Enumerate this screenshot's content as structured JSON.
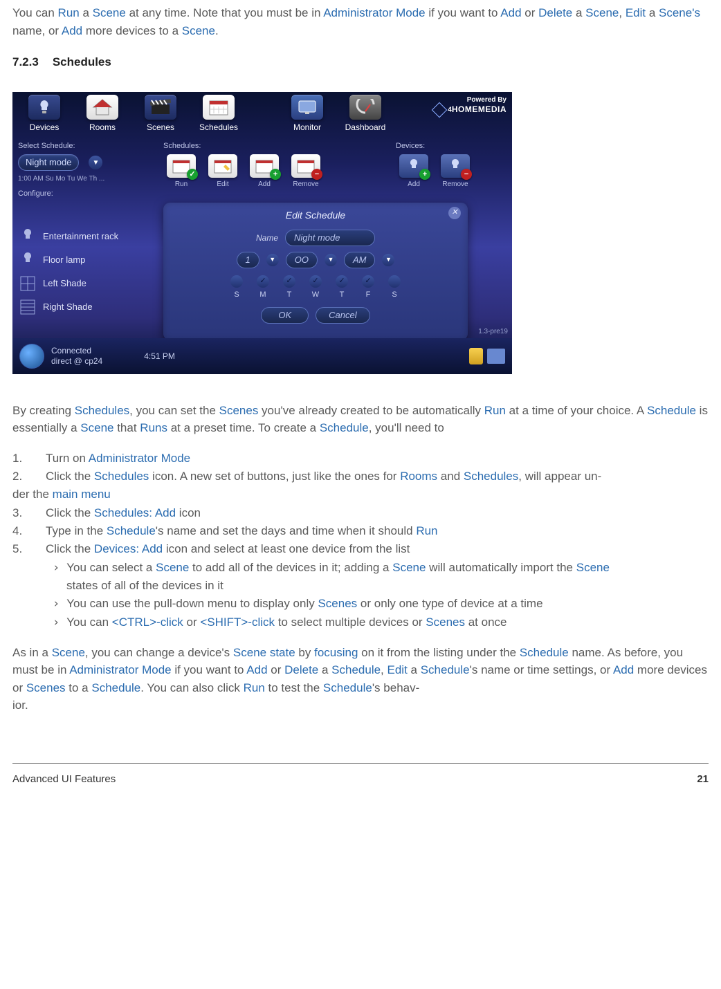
{
  "intro": {
    "t1": "You can ",
    "run": "Run",
    "t2": " a ",
    "scene1": "Scene",
    "t3": " at any time. Note that you must be in ",
    "adminmode": "Administrator Mode",
    "t4": " if you want to ",
    "add": "Add",
    "t5": " or ",
    "delete": "Delete",
    "t6": " a ",
    "scene2": "Scene",
    "t7": ", ",
    "edit": "Edit",
    "t8": " a ",
    "scenes": "Scene's",
    "t9": " name, or ",
    "add2": "Add",
    "t10": " more devices to a ",
    "scene3": "Scene",
    "t11": "."
  },
  "section": {
    "num": "7.2.3",
    "title": "Schedules"
  },
  "app": {
    "topnav": [
      "Devices",
      "Rooms",
      "Scenes",
      "Schedules",
      "Monitor",
      "Dashboard"
    ],
    "logo_powered": "Powered By",
    "logo_brand": "HOMEMEDIA",
    "logo_four": "4",
    "select_label": "Select Schedule:",
    "select_value": "Night mode",
    "select_time": "1:00 AM Su Mo Tu We Th ...",
    "configure_label": "Configure:",
    "schedules_label": "Schedules:",
    "devices_label": "Devices:",
    "sched_actions": [
      "Run",
      "Edit",
      "Add",
      "Remove"
    ],
    "dev_actions": [
      "Add",
      "Remove"
    ],
    "dev_items": [
      "Entertainment rack",
      "Floor lamp",
      "Left Shade",
      "Right Shade"
    ],
    "dialog": {
      "title": "Edit Schedule",
      "name_label": "Name",
      "name_value": "Night mode",
      "hour": "1",
      "minute": "OO",
      "ampm": "AM",
      "days": [
        "S",
        "M",
        "T",
        "W",
        "T",
        "F",
        "S"
      ],
      "checked": [
        false,
        true,
        true,
        true,
        true,
        true,
        false
      ],
      "ok": "OK",
      "cancel": "Cancel"
    },
    "status": {
      "connected": "Connected",
      "direct": "direct @ cp24",
      "time": "4:51 PM",
      "version": "1.3-pre19"
    }
  },
  "para2": {
    "t1": "By creating ",
    "schedules": "Schedules",
    "t2": ", you can set the ",
    "scenes": "Scenes",
    "t3": " you've already created to be automatically ",
    "run": "Run",
    "t4": " at a time of your choice. A ",
    "schedule": "Schedule",
    "t5": " is essentially a ",
    "scene": "Scene",
    "t6": " that ",
    "runs": "Runs",
    "t7": " at a preset time. To create a ",
    "schedule2": "Schedule",
    "t8": ", you'll need to"
  },
  "steps": {
    "s1": {
      "n": "1.",
      "t1": "Turn on ",
      "adminmode": "Administrator Mode"
    },
    "s2": {
      "n": "2.",
      "t1": "Click the ",
      "schedules": "Schedules",
      "t2": " icon. A new set of buttons, just like the ones for ",
      "rooms": "Rooms",
      "t3": " and ",
      "schedules2": "Schedules",
      "t4": ", will appear un-",
      "t5": "der the ",
      "mainmenu": "main menu"
    },
    "s3": {
      "n": "3.",
      "t1": "Click the ",
      "sa": "Schedules: Add",
      "t2": " icon"
    },
    "s4": {
      "n": "4.",
      "t1": "Type in the ",
      "schedule": "Schedule",
      "t2": "'s name and set the days and time when it should ",
      "run": "Run"
    },
    "s5": {
      "n": "5.",
      "t1": "Click the ",
      "da": "Devices: Add",
      "t2": " icon and select at least one device from the list"
    },
    "sub1": {
      "t1": "You can select a ",
      "scene": "Scene",
      "t2": " to add all of the devices in it; adding a ",
      "scene2": "Scene",
      "t3": " will automatically import the ",
      "scene3": "Scene",
      "t4": "states of all of the devices in it"
    },
    "sub2": {
      "t1": "You can use the pull-down menu to display only ",
      "scenes": "Scenes",
      "t2": " or only one type of device at a time"
    },
    "sub3": {
      "t1": "You can ",
      "ctrl": "<CTRL>-click",
      "t2": " or ",
      "shift": "<SHIFT>-click",
      "t3": " to select multiple devices or ",
      "scenes": "Scenes",
      "t4": " at once"
    }
  },
  "para3": {
    "t1": "As in a ",
    "scene": "Scene",
    "t2": ", you can change a device's ",
    "scenestate": "Scene state",
    "t3": " by ",
    "focusing": "focusing",
    "t4": " on it from the listing under the ",
    "schedule": "Schedule",
    "t5": " name. As before, you must be in ",
    "adminmode": "Administrator Mode",
    "t6": " if you want to ",
    "add": "Add",
    "t7": " or ",
    "delete": "Delete",
    "t8": " a ",
    "schedule2": "Schedule",
    "t9": ", ",
    "edit": "Edit",
    "t10": " a ",
    "schedules": "Schedule",
    "t11": "'s name or time settings, or ",
    "add2": "Add",
    "t12": " more devices or ",
    "scenes": "Scenes",
    "t13": " to a ",
    "schedule3": "Schedule",
    "t14": ". You can also click ",
    "run": "Run",
    "t15": " to test the ",
    "schedules2": "Schedule",
    "t16": "'s behav-",
    "t17": "ior."
  },
  "footer": {
    "title": "Advanced UI Features",
    "page": "21"
  },
  "chevron": "›"
}
